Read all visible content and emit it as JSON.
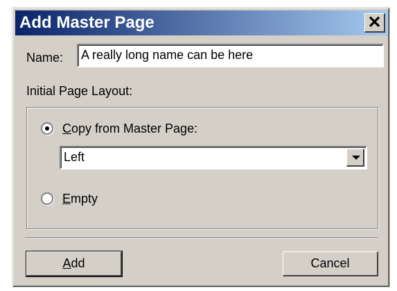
{
  "dialog": {
    "title": "Add Master Page",
    "close_glyph": "✕"
  },
  "name_field": {
    "label": "Name:",
    "value": "A really long name can be here"
  },
  "layout_group": {
    "label": "Initial Page Layout:",
    "copy_option": {
      "mnemonic": "C",
      "rest": "opy from Master Page:",
      "selected": true
    },
    "dropdown": {
      "value": "Left"
    },
    "empty_option": {
      "mnemonic": "E",
      "rest": "mpty",
      "selected": false
    }
  },
  "buttons": {
    "add": {
      "mnemonic": "A",
      "rest": "dd"
    },
    "cancel": "Cancel"
  }
}
